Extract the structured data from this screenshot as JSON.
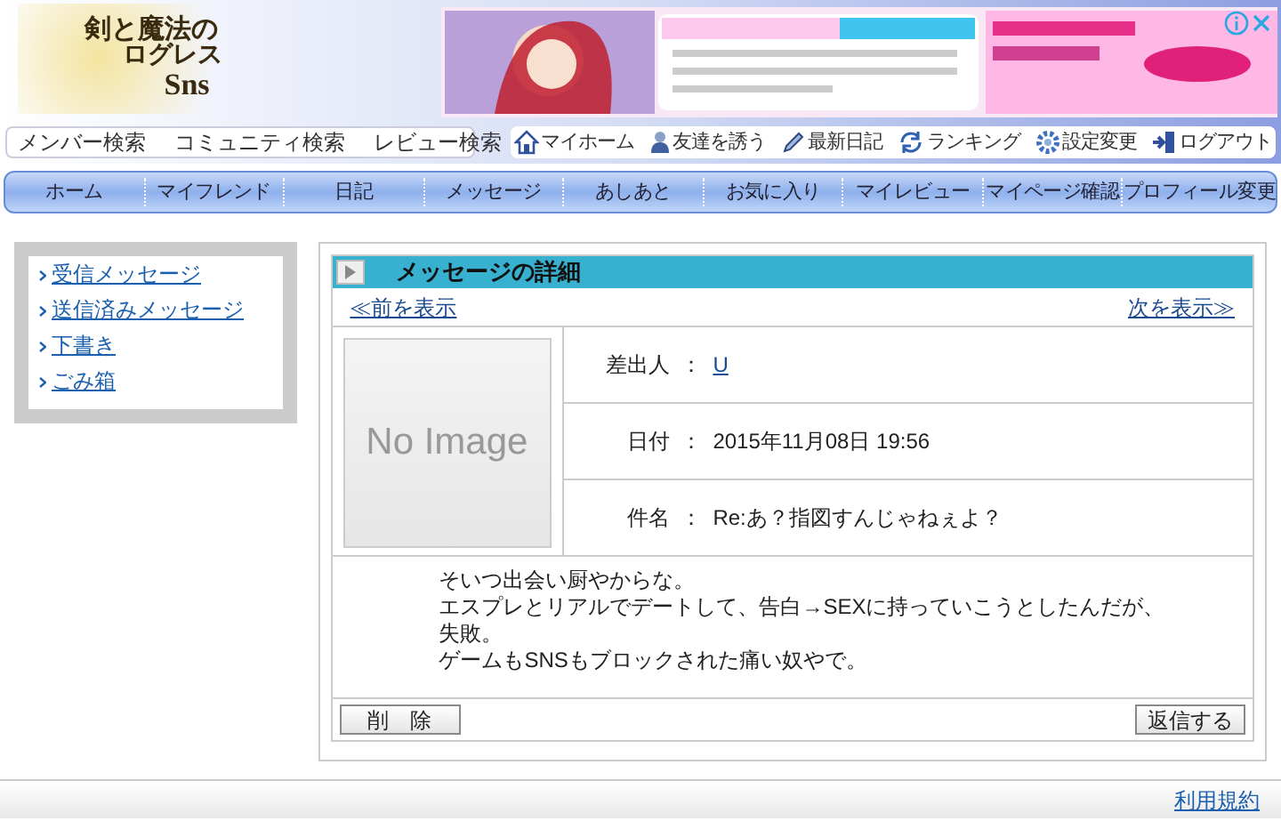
{
  "header": {
    "logo": {
      "line_1": "剣と魔法の",
      "line_2": "ログレス",
      "line_3": "Sns"
    },
    "ad": {
      "kind": "picture"
    },
    "search_links": [
      "メンバー検索",
      "コミュニティ検索",
      "レビュー検索"
    ],
    "user_links": [
      "マイホーム",
      "友達を誘う",
      "最新日記",
      "ランキング",
      "設定変更",
      "ログアウト"
    ]
  },
  "nav": [
    "ホーム",
    "マイフレンド",
    "日記",
    "メッセージ",
    "あしあと",
    "お気に入り",
    "マイレビュー",
    "マイページ確認",
    "プロフィール変更"
  ],
  "sidebar": {
    "items": [
      "受信メッセージ",
      "送信済みメッセージ",
      "下書き",
      "ごみ箱"
    ]
  },
  "message": {
    "title": "メッセージの詳細",
    "prev": "≪前を表示",
    "next": "次を表示≫",
    "avatar_text": "No Image",
    "fields": [
      {
        "label": "差出人",
        "separator": "：",
        "value": "U",
        "kind": "link"
      },
      {
        "label": "日付",
        "separator": "：",
        "value": "2015年11月08日 19:56",
        "kind": "text"
      },
      {
        "label": "件名",
        "separator": "：",
        "value": "Re:あ？指図すんじゃねぇよ？",
        "kind": "text"
      }
    ],
    "body": [
      "そいつ出会い厨やからな。",
      "エスプレとリアルでデートして、告白→SEXに持っていこうとしたんだが、失敗。",
      "ゲームもSNSもブロックされた痛い奴やで。"
    ],
    "delete_button": "削　除",
    "reply_button": "返信する"
  },
  "footer": {
    "terms_link": "利用規約"
  }
}
